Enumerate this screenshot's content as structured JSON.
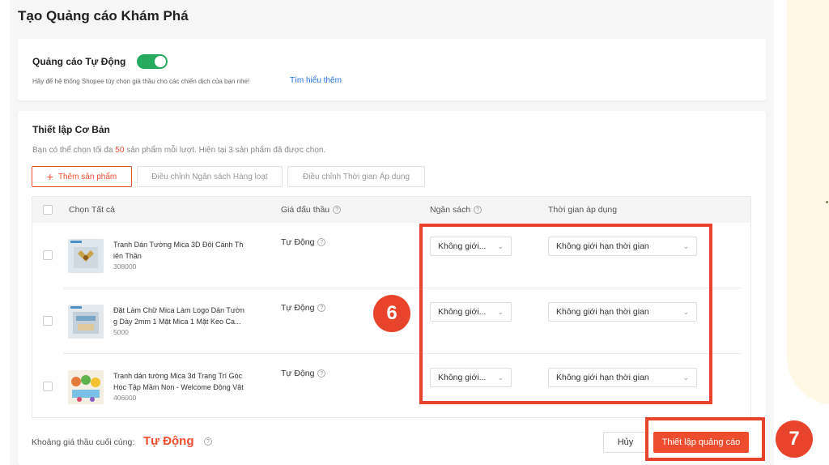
{
  "page": {
    "title": "Tạo Quảng cáo Khám Phá"
  },
  "auto_ads": {
    "label": "Quảng cáo Tự Động",
    "enabled": true,
    "hint": "Hãy để hệ thống Shopee tùy chọn giá thầu cho các chiến dịch của bạn nhé!",
    "learn_more": "Tìm hiểu thêm"
  },
  "basic": {
    "title": "Thiết lập Cơ Bản",
    "limit_prefix": "Bạn có thể chọn tối đa ",
    "limit_count": "50",
    "limit_suffix": " sản phẩm mỗi lượt. Hiện tại 3 sản phẩm đã được chọn.",
    "add_product": "Thêm sản phẩm",
    "bulk_budget": "Điều chỉnh Ngân sách Hàng loạt",
    "bulk_time": "Điều chỉnh Thời gian Áp dụng",
    "columns": {
      "select_all": "Chọn Tất cả",
      "bid": "Giá đấu thầu",
      "budget": "Ngân sách",
      "time": "Thời gian áp dụng"
    },
    "products": [
      {
        "name_line1": "Tranh Dán Tường Mica 3D Đôi Cánh Th",
        "name_line2": "iên Thần",
        "price": "308000",
        "bid": "Tự Động",
        "budget": "Không giới...",
        "time": "Không giới hạn thời gian"
      },
      {
        "name_line1": "Đặt Làm Chữ Mica Làm Logo Dán Tườn",
        "name_line2": "g Dày 2mm 1 Mặt Mica 1 Mặt Keo Ca...",
        "price": "5000",
        "bid": "Tự Động",
        "budget": "Không giới...",
        "time": "Không giới hạn thời gian"
      },
      {
        "name_line1": "Tranh dán tường Mica 3d Trang Trí Góc",
        "name_line2": "Học Tập Mầm Non - Welcome Động Vật",
        "price": "406000",
        "bid": "Tự Động",
        "budget": "Không giới...",
        "time": "Không giới hạn thời gian"
      }
    ],
    "footer_label": "Khoảng giá thầu cuối cùng:",
    "footer_value": "Tự Động",
    "cancel": "Hủy",
    "submit": "Thiết lập quảng cáo"
  },
  "annotations": {
    "step6": "6",
    "step7": "7"
  },
  "colors": {
    "accent": "#ee4d2d",
    "toggle_on": "#26aa5f",
    "link": "#2673dd",
    "annotation": "#e8442b"
  },
  "icons": [
    "help-icon",
    "chevron-down-icon",
    "plus-icon",
    "checkbox-icon"
  ]
}
